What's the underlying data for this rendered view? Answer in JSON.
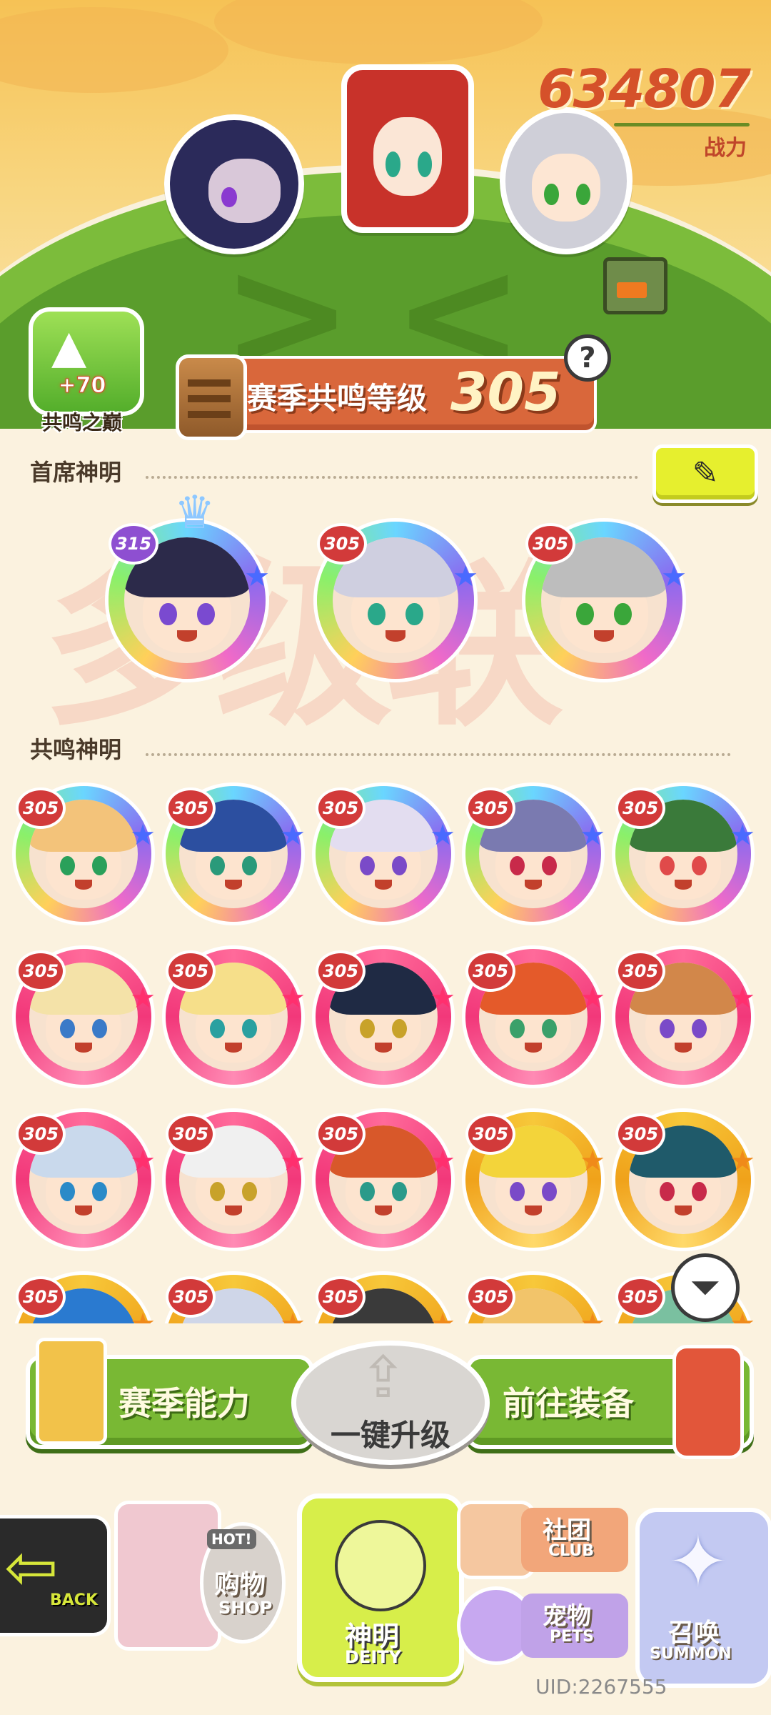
{
  "header": {
    "combat_power": "634807",
    "combat_power_label": "战力",
    "resonance_peak": {
      "bonus": "+70",
      "label": "共鸣之巅"
    },
    "season_resonance": {
      "label": "赛季共鸣等级",
      "level": "305"
    },
    "help_icon": "?"
  },
  "chief_deities": {
    "title": "首席神明",
    "edit_icon": "pencil-icon",
    "watermark": "多级联",
    "items": [
      {
        "level": "315",
        "ring": "rainbow",
        "hair": "#2c2a4a",
        "eye": "#7a4ad0",
        "crown": true
      },
      {
        "level": "305",
        "ring": "rainbow",
        "hair": "#cfcfe0",
        "eye": "#2aa88a",
        "crown": false
      },
      {
        "level": "305",
        "ring": "rainbow",
        "hair": "#bdbdbd",
        "eye": "#3aa63a",
        "crown": false
      }
    ]
  },
  "resonance_deities": {
    "title": "共鸣神明",
    "items": [
      {
        "level": "305",
        "ring": "rainbow",
        "hair": "#f3c37a",
        "eye": "#2aa05a"
      },
      {
        "level": "305",
        "ring": "rainbow",
        "hair": "#2c4fa0",
        "eye": "#2a9a7a"
      },
      {
        "level": "305",
        "ring": "rainbow",
        "hair": "#e3ddf0",
        "eye": "#7a4ac8"
      },
      {
        "level": "305",
        "ring": "rainbow",
        "hair": "#7a7ab0",
        "eye": "#c82a4a"
      },
      {
        "level": "305",
        "ring": "rainbow",
        "hair": "#3a7a3a",
        "eye": "#e04a4a"
      },
      {
        "level": "305",
        "ring": "pink",
        "hair": "#f4e2a8",
        "eye": "#3a7ac8"
      },
      {
        "level": "305",
        "ring": "pink",
        "hair": "#f6df8a",
        "eye": "#2aa0a0"
      },
      {
        "level": "305",
        "ring": "pink",
        "hair": "#1f2a44",
        "eye": "#c8a22a"
      },
      {
        "level": "305",
        "ring": "pink",
        "hair": "#e45a2a",
        "eye": "#3aa06a"
      },
      {
        "level": "305",
        "ring": "pink",
        "hair": "#d2874a",
        "eye": "#7a4ac8"
      },
      {
        "level": "305",
        "ring": "pink",
        "hair": "#c9d9ec",
        "eye": "#2a8ac8"
      },
      {
        "level": "305",
        "ring": "pink",
        "hair": "#f0f0f0",
        "eye": "#c8a22a"
      },
      {
        "level": "305",
        "ring": "pink",
        "hair": "#d8582a",
        "eye": "#2a9a8a"
      },
      {
        "level": "305",
        "ring": "gold",
        "hair": "#f3d43a",
        "eye": "#7a4ac8"
      },
      {
        "level": "305",
        "ring": "gold",
        "hair": "#1f5a6a",
        "eye": "#c82a4a"
      },
      {
        "level": "305",
        "ring": "gold",
        "hair": "#2a7ad0",
        "eye": "#2a2a2a"
      },
      {
        "level": "305",
        "ring": "gold",
        "hair": "#cfd6e8",
        "eye": "#2a2a2a"
      },
      {
        "level": "305",
        "ring": "gold",
        "hair": "#3a3a3a",
        "eye": "#2a2a2a"
      },
      {
        "level": "305",
        "ring": "gold",
        "hair": "#f2c46a",
        "eye": "#2a2a2a"
      },
      {
        "level": "305",
        "ring": "gold",
        "hair": "#7ac0a0",
        "eye": "#2a2a2a"
      }
    ]
  },
  "filter_icon": "filter-icon",
  "actions": {
    "season_ability": "赛季能力",
    "upgrade_all": "一键升级",
    "go_equipment": "前往装备"
  },
  "bottom_nav": {
    "back": "BACK",
    "shop_cn": "购物",
    "shop_en": "SHOP",
    "hot": "HOT!",
    "deity_cn": "神明",
    "deity_en": "DEITY",
    "club_cn": "社团",
    "club_en": "CLUB",
    "pets_cn": "宠物",
    "pets_en": "PETS",
    "summon_cn": "召唤",
    "summon_en": "SUMMON"
  },
  "uid": "UID:2267555",
  "colors": {
    "accent_green": "#79b834",
    "banner_orange": "#d9673b",
    "level_red": "#d23a3a",
    "background": "#fbf2df"
  }
}
